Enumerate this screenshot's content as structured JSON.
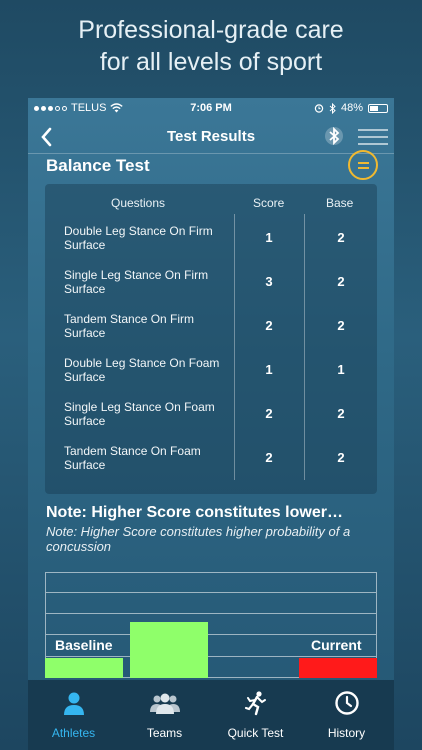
{
  "headline": {
    "line1": "Professional-grade care",
    "line2": "for all levels of sport"
  },
  "status_bar": {
    "carrier": "TELUS",
    "time": "7:06 PM",
    "battery": "48%",
    "battery_level": 0.48
  },
  "nav": {
    "title": "Test Results"
  },
  "section": {
    "title": "Balance Test"
  },
  "table": {
    "headers": [
      "Questions",
      "Score",
      "Base"
    ],
    "rows": [
      {
        "question": "Double Leg Stance On Firm Surface",
        "score": "1",
        "base": "2"
      },
      {
        "question": "Single Leg Stance On Firm Surface",
        "score": "3",
        "base": "2"
      },
      {
        "question": "Tandem Stance On Firm Surface",
        "score": "2",
        "base": "2"
      },
      {
        "question": "Double Leg Stance On Foam Surface",
        "score": "1",
        "base": "1"
      },
      {
        "question": "Single Leg Stance On Foam Surface",
        "score": "2",
        "base": "2"
      },
      {
        "question": "Tandem Stance On Foam Surface",
        "score": "2",
        "base": "2"
      }
    ]
  },
  "note": {
    "bold": "Note: Higher Score constitutes lower…",
    "italic": "Note: Higher Score constitutes higher probability of a concussion"
  },
  "chart": {
    "baseline_label": "Baseline",
    "current_label": "Current",
    "colors": {
      "baseline": "#8fff6a",
      "current": "#ff1a1a"
    }
  },
  "tabs": [
    {
      "label": "Athletes",
      "icon": "person-icon",
      "active": true
    },
    {
      "label": "Teams",
      "icon": "group-icon",
      "active": false
    },
    {
      "label": "Quick Test",
      "icon": "runner-icon",
      "active": false
    },
    {
      "label": "History",
      "icon": "clock-icon",
      "active": false
    }
  ],
  "colors": {
    "accent_active": "#35b6f0",
    "menu_ring": "#f0b930"
  }
}
